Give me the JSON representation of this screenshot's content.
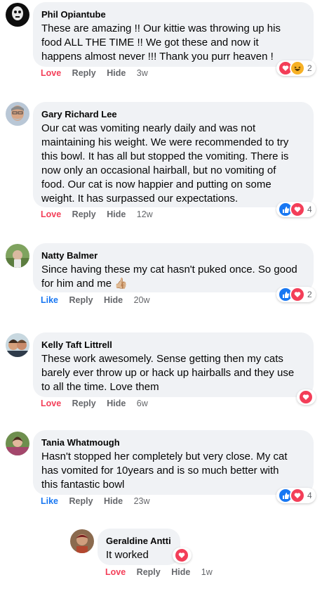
{
  "comments": [
    {
      "name": "Phil Opiantube",
      "lines": [
        "These are amazing !! Our kittie was throwing up his",
        "food ALL THE TIME !! We got these and now it",
        "happens almost never !!! Thank you purr heaven !"
      ],
      "actions": {
        "react": "Love",
        "reply": "Reply",
        "hide": "Hide",
        "time": "3w"
      },
      "reactions": {
        "icons": [
          "love-icon",
          "haha-icon"
        ],
        "count": "2"
      }
    },
    {
      "name": "Gary Richard Lee",
      "lines": [
        "Our cat was vomiting nearly daily and was not",
        "maintaining his weight. We were recommended to try",
        "this bowl. It has all but stopped the vomiting. There is",
        "now only an occasional hairball, but no vomiting of",
        "food. Our cat is now happier and putting on some",
        "weight. It has surpassed our expectations."
      ],
      "actions": {
        "react": "Love",
        "reply": "Reply",
        "hide": "Hide",
        "time": "12w"
      },
      "reactions": {
        "icons": [
          "like-icon",
          "love-icon"
        ],
        "count": "4"
      }
    },
    {
      "name": "Natty Balmer",
      "lines": [
        "Since having these my cat hasn't puked once. So good",
        "for him and me 👍🏼"
      ],
      "actions": {
        "react": "Like",
        "reply": "Reply",
        "hide": "Hide",
        "time": "20w"
      },
      "reactions": {
        "icons": [
          "like-icon",
          "love-icon"
        ],
        "count": "2"
      }
    },
    {
      "name": "Kelly Taft Littrell",
      "lines": [
        "These work awesomely. Sense getting then my cats",
        "barely ever throw up or hack up hairballs and they use",
        "to all the time. Love them"
      ],
      "actions": {
        "react": "Love",
        "reply": "Reply",
        "hide": "Hide",
        "time": "6w"
      },
      "reactions": {
        "icons": [
          "love-icon"
        ],
        "count": ""
      }
    },
    {
      "name": "Tania Whatmough",
      "lines": [
        "Hasn't stopped her completely but very close. My cat",
        "has vomited for 10years and is so much better with",
        "this fantastic bowl"
      ],
      "actions": {
        "react": "Like",
        "reply": "Reply",
        "hide": "Hide",
        "time": "23w"
      },
      "reactions": {
        "icons": [
          "like-icon",
          "love-icon"
        ],
        "count": "4"
      }
    },
    {
      "name": "Geraldine Antti",
      "lines": [
        "It worked"
      ],
      "actions": {
        "react": "Love",
        "reply": "Reply",
        "hide": "Hide",
        "time": "1w"
      },
      "reactions": {
        "icons": [
          "love-icon"
        ],
        "count": ""
      }
    }
  ],
  "colors": {
    "bubble": "#f0f2f5",
    "love": "#f33e58",
    "like": "#1877f2",
    "meta": "#65676b",
    "haha": "#f7b125"
  }
}
